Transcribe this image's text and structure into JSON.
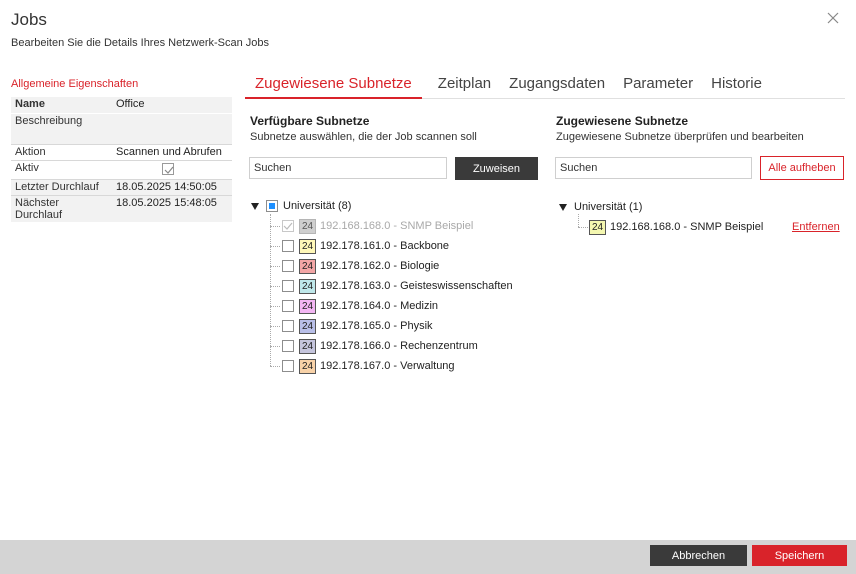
{
  "header": {
    "title": "Jobs",
    "subtitle": "Bearbeiten Sie die Details Ihres Netzwerk-Scan Jobs"
  },
  "properties": {
    "title": "Allgemeine Eigenschaften",
    "rows": [
      {
        "key": "Name",
        "value": "Office"
      },
      {
        "key": "Beschreibung",
        "value": ""
      },
      {
        "key": "Aktion",
        "value": "Scannen und Abrufen"
      },
      {
        "key": "Aktiv",
        "checked": true
      },
      {
        "key": "Letzter Durchlauf",
        "value": "18.05.2025 14:50:05"
      },
      {
        "key": "Nächster Durchlauf",
        "value": "18.05.2025 15:48:05"
      }
    ]
  },
  "tabs": [
    "Zugewiesene Subnetze",
    "Zeitplan",
    "Zugangsdaten",
    "Parameter",
    "Historie"
  ],
  "available": {
    "title": "Verfügbare Subnetze",
    "subtitle": "Subnetze auswählen, die der Job scannen soll",
    "search_placeholder": "Suchen",
    "assign_label": "Zuweisen",
    "group_label": "Universität (8)",
    "items": [
      {
        "prefix": "24",
        "label": "192.168.168.0 - SNMP Beispiel",
        "color": "#cfcfcf",
        "disabled": true
      },
      {
        "prefix": "24",
        "label": "192.178.161.0 - Backbone",
        "color": "#fff8b8"
      },
      {
        "prefix": "24",
        "label": "192.178.162.0 - Biologie",
        "color": "#f3a6a6"
      },
      {
        "prefix": "24",
        "label": "192.178.163.0 - Geisteswissenschaften",
        "color": "#bfe8ea"
      },
      {
        "prefix": "24",
        "label": "192.178.164.0 - Medizin",
        "color": "#f3b6f3"
      },
      {
        "prefix": "24",
        "label": "192.178.165.0 - Physik",
        "color": "#b9bfe8"
      },
      {
        "prefix": "24",
        "label": "192.178.166.0 - Rechenzentrum",
        "color": "#c5c5dd"
      },
      {
        "prefix": "24",
        "label": "192.178.167.0 - Verwaltung",
        "color": "#f8d2a8"
      }
    ]
  },
  "assigned": {
    "title": "Zugewiesene Subnetze",
    "subtitle": "Zugewiesene Subnetze überprüfen und bearbeiten",
    "search_placeholder": "Suchen",
    "clear_label": "Alle aufheben",
    "group_label": "Universität (1)",
    "item": {
      "prefix": "24",
      "label": "192.168.168.0 - SNMP Beispiel",
      "color": "#f4f7b0"
    },
    "remove_label": "Entfernen"
  },
  "footer": {
    "cancel_label": "Abbrechen",
    "save_label": "Speichern"
  },
  "colors": {
    "accent": "#d9232a",
    "dark_button": "#3a3a3a",
    "footer_bg": "#d4d4d4"
  }
}
